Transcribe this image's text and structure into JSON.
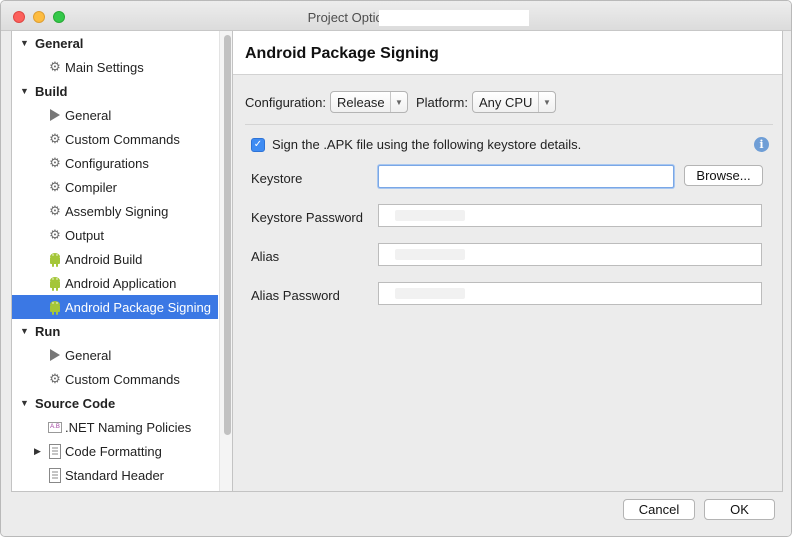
{
  "window": {
    "title": "Project Options -"
  },
  "sidebar": {
    "rows": [
      {
        "type": "category",
        "label": "General",
        "expanded": true
      },
      {
        "type": "item",
        "label": "Main Settings",
        "icon": "gear-icon"
      },
      {
        "type": "category",
        "label": "Build",
        "expanded": true
      },
      {
        "type": "item",
        "label": "General",
        "icon": "play-icon"
      },
      {
        "type": "item",
        "label": "Custom Commands",
        "icon": "gear-icon"
      },
      {
        "type": "item",
        "label": "Configurations",
        "icon": "gear-icon"
      },
      {
        "type": "item",
        "label": "Compiler",
        "icon": "gear-icon"
      },
      {
        "type": "item",
        "label": "Assembly Signing",
        "icon": "gear-icon"
      },
      {
        "type": "item",
        "label": "Output",
        "icon": "gear-icon"
      },
      {
        "type": "item",
        "label": "Android Build",
        "icon": "android-icon"
      },
      {
        "type": "item",
        "label": "Android Application",
        "icon": "android-icon"
      },
      {
        "type": "item",
        "label": "Android Package Signing",
        "icon": "android-icon",
        "selected": true
      },
      {
        "type": "category",
        "label": "Run",
        "expanded": true
      },
      {
        "type": "item",
        "label": "General",
        "icon": "play-icon"
      },
      {
        "type": "item",
        "label": "Custom Commands",
        "icon": "gear-icon"
      },
      {
        "type": "category",
        "label": "Source Code",
        "expanded": true
      },
      {
        "type": "item",
        "label": ".NET Naming Policies",
        "icon": "naming-icon"
      },
      {
        "type": "item",
        "label": "Code Formatting",
        "icon": "document-icon",
        "collapsed": true
      },
      {
        "type": "item",
        "label": "Standard Header",
        "icon": "document-icon"
      }
    ]
  },
  "main": {
    "title": "Android Package Signing",
    "configuration_label": "Configuration:",
    "configuration_value": "Release",
    "platform_label": "Platform:",
    "platform_value": "Any CPU",
    "sign_checkbox_label": "Sign the .APK file using the following keystore details.",
    "sign_checked": true,
    "keystore_label": "Keystore",
    "keystore_value": "",
    "browse_label": "Browse...",
    "keystore_password_label": "Keystore Password",
    "alias_label": "Alias",
    "alias_password_label": "Alias Password"
  },
  "footer": {
    "cancel_label": "Cancel",
    "ok_label": "OK"
  },
  "colors": {
    "selection": "#3b78e4",
    "checkbox": "#3f8cf3",
    "android_green": "#a4c639"
  }
}
